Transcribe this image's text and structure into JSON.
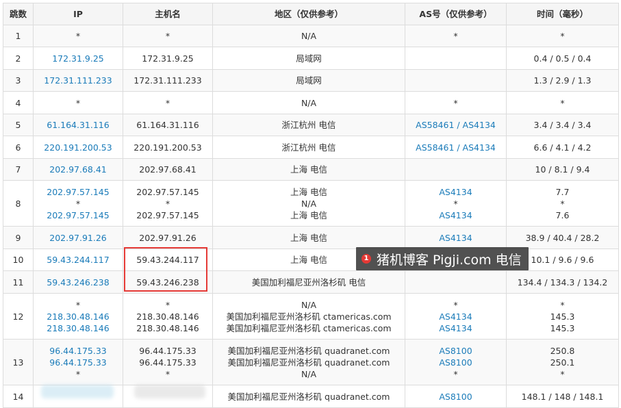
{
  "headers": [
    "跳数",
    "IP",
    "主机名",
    "地区（仅供参考）",
    "AS号（仅供参考）",
    "时间（毫秒）"
  ],
  "rows": [
    {
      "hop": "1",
      "ip": [
        "*"
      ],
      "host": [
        "*"
      ],
      "region": [
        "N/A"
      ],
      "asn": [
        "*"
      ],
      "time": [
        "*"
      ],
      "ip_link": false
    },
    {
      "hop": "2",
      "ip": [
        "172.31.9.25"
      ],
      "host": [
        "172.31.9.25"
      ],
      "region": [
        "局域网"
      ],
      "asn": [
        ""
      ],
      "time": [
        "0.4 / 0.5 / 0.4"
      ],
      "ip_link": true
    },
    {
      "hop": "3",
      "ip": [
        "172.31.111.233"
      ],
      "host": [
        "172.31.111.233"
      ],
      "region": [
        "局域网"
      ],
      "asn": [
        ""
      ],
      "time": [
        "1.3 / 2.9 / 1.3"
      ],
      "ip_link": true
    },
    {
      "hop": "4",
      "ip": [
        "*"
      ],
      "host": [
        "*"
      ],
      "region": [
        "N/A"
      ],
      "asn": [
        "*"
      ],
      "time": [
        "*"
      ],
      "ip_link": false
    },
    {
      "hop": "5",
      "ip": [
        "61.164.31.116"
      ],
      "host": [
        "61.164.31.116"
      ],
      "region": [
        "浙江杭州 电信"
      ],
      "asn": [
        "AS58461 / AS4134"
      ],
      "time": [
        "3.4 / 3.4 / 3.4"
      ],
      "ip_link": true
    },
    {
      "hop": "6",
      "ip": [
        "220.191.200.53"
      ],
      "host": [
        "220.191.200.53"
      ],
      "region": [
        "浙江杭州 电信"
      ],
      "asn": [
        "AS58461 / AS4134"
      ],
      "time": [
        "6.6 / 4.1 / 4.2"
      ],
      "ip_link": true
    },
    {
      "hop": "7",
      "ip": [
        "202.97.68.41"
      ],
      "host": [
        "202.97.68.41"
      ],
      "region": [
        "上海 电信"
      ],
      "asn": [
        ""
      ],
      "time": [
        "10 / 8.1 / 9.4"
      ],
      "ip_link": true
    },
    {
      "hop": "8",
      "ip": [
        "202.97.57.145",
        "*",
        "202.97.57.145"
      ],
      "host": [
        "202.97.57.145",
        "*",
        "202.97.57.145"
      ],
      "region": [
        "上海 电信",
        "N/A",
        "上海 电信"
      ],
      "asn": [
        "AS4134",
        "*",
        "AS4134"
      ],
      "time": [
        "7.7",
        "*",
        "7.6"
      ],
      "ip_link": true
    },
    {
      "hop": "9",
      "ip": [
        "202.97.91.26"
      ],
      "host": [
        "202.97.91.26"
      ],
      "region": [
        "上海 电信"
      ],
      "asn": [
        "AS4134"
      ],
      "time": [
        "38.9 / 40.4 / 28.2"
      ],
      "ip_link": true
    },
    {
      "hop": "10",
      "ip": [
        "59.43.244.117"
      ],
      "host": [
        "59.43.244.117"
      ],
      "region": [
        "上海 电信"
      ],
      "asn": [
        ""
      ],
      "time": [
        "10.1 / 9.6 / 9.6"
      ],
      "ip_link": true
    },
    {
      "hop": "11",
      "ip": [
        "59.43.246.238"
      ],
      "host": [
        "59.43.246.238"
      ],
      "region": [
        "美国加利福尼亚州洛杉矶 电信"
      ],
      "asn": [
        ""
      ],
      "time": [
        "134.4 / 134.3 / 134.2"
      ],
      "ip_link": true
    },
    {
      "hop": "12",
      "ip": [
        "*",
        "218.30.48.146",
        "218.30.48.146"
      ],
      "host": [
        "*",
        "218.30.48.146",
        "218.30.48.146"
      ],
      "region": [
        "N/A",
        "美国加利福尼亚州洛杉矶 ctamericas.com",
        "美国加利福尼亚州洛杉矶 ctamericas.com"
      ],
      "asn": [
        "*",
        "AS4134",
        "AS4134"
      ],
      "time": [
        "*",
        "145.3",
        "145.3"
      ],
      "ip_link": true
    },
    {
      "hop": "13",
      "ip": [
        "96.44.175.33",
        "96.44.175.33",
        "*"
      ],
      "host": [
        "96.44.175.33",
        "96.44.175.33",
        "*"
      ],
      "region": [
        "美国加利福尼亚州洛杉矶 quadranet.com",
        "美国加利福尼亚州洛杉矶 quadranet.com",
        "N/A"
      ],
      "asn": [
        "AS8100",
        "AS8100",
        "*"
      ],
      "time": [
        "250.8",
        "250.1",
        "*"
      ],
      "ip_link": true
    },
    {
      "hop": "14",
      "ip": [
        ""
      ],
      "host": [
        ""
      ],
      "region": [
        "美国加利福尼亚州洛杉矶 quadranet.com"
      ],
      "asn": [
        "AS8100"
      ],
      "time": [
        "148.1 / 148 / 148.1"
      ],
      "ip_link": true
    }
  ],
  "watermark": {
    "badge": "1",
    "text": "猪机博客 Pigji.com 电信"
  },
  "colors": {
    "link": "#1a7bb9",
    "highlight": "#e53935"
  }
}
